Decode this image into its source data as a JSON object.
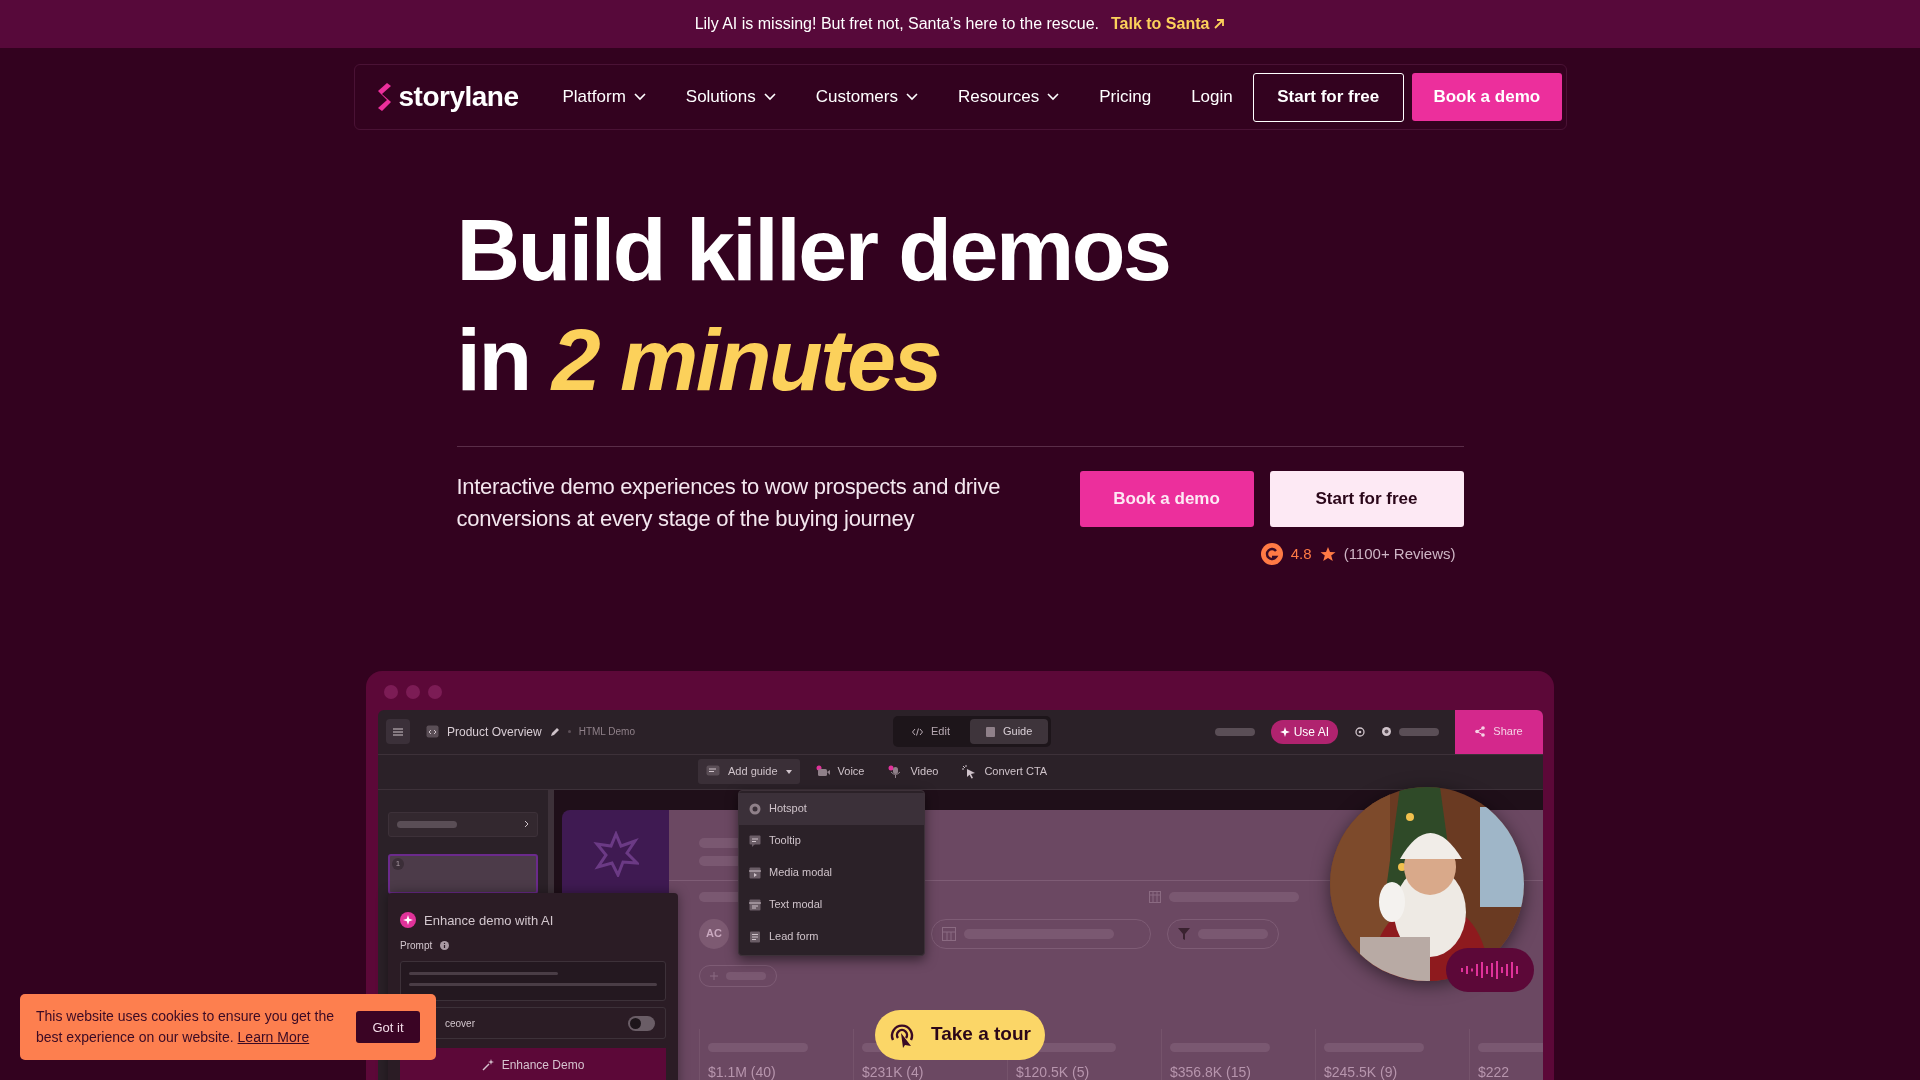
{
  "announcement": {
    "text": "Lily AI is missing! But fret not, Santa’s here to the rescue.",
    "link": "Talk to Santa"
  },
  "nav": {
    "logo": "storylane",
    "items": [
      {
        "label": "Platform",
        "has_menu": true
      },
      {
        "label": "Solutions",
        "has_menu": true
      },
      {
        "label": "Customers",
        "has_menu": true
      },
      {
        "label": "Resources",
        "has_menu": true
      },
      {
        "label": "Pricing",
        "has_menu": false
      },
      {
        "label": "Login",
        "has_menu": false
      }
    ],
    "buttons": [
      {
        "label": "Start for free",
        "kind": "outline"
      },
      {
        "label": "Book a demo",
        "kind": "primary"
      }
    ]
  },
  "hero": {
    "title": "Build killer demos",
    "title_start": "in",
    "title_highlight": "2 minutes",
    "subtitle": "Interactive demo experiences to wow prospects and drive conversions at every stage of the buying journey",
    "buttons": [
      {
        "label": "Book a demo",
        "kind": "primary"
      },
      {
        "label": "Start for free",
        "kind": "light"
      }
    ],
    "rating": {
      "score": "4.8",
      "reviews": "(1100+ Reviews)"
    }
  },
  "demo": {
    "title": "Product Overview",
    "subtitle": "HTML Demo",
    "modes": [
      {
        "label": "Edit",
        "selected": false
      },
      {
        "label": "Guide",
        "selected": true
      }
    ],
    "ai_button": "Use AI",
    "share": "Share",
    "tools": [
      {
        "label": "Add guide",
        "kind": "dropdown"
      },
      {
        "label": "Voice",
        "kind": "voice"
      },
      {
        "label": "Video",
        "kind": "video"
      },
      {
        "label": "Convert CTA",
        "kind": "cta"
      }
    ],
    "guide_menu": [
      {
        "label": "Hotspot",
        "kind": "hotspot",
        "selected": true
      },
      {
        "label": "Tooltip",
        "kind": "tooltip",
        "selected": false
      },
      {
        "label": "Media modal",
        "kind": "media",
        "selected": false
      },
      {
        "label": "Text modal",
        "kind": "text",
        "selected": false
      },
      {
        "label": "Lead form",
        "kind": "form",
        "selected": false
      }
    ],
    "step_number": "1",
    "avatar": "AC",
    "stats": [
      "$1.1M (40)",
      "$231K (4)",
      "$120.5K (5)",
      "$356.8K (15)",
      "$245.5K (9)",
      "$222"
    ],
    "enhance": {
      "title": "Enhance demo with AI",
      "prompt_label": "Prompt",
      "option": "ceover",
      "option_on": false,
      "button": "Enhance Demo"
    }
  },
  "tour_button": "Take a tour",
  "cookie": {
    "text": "This website uses cookies to ensure you get the best experience on our website.",
    "link": "Learn More",
    "button": "Got it"
  }
}
